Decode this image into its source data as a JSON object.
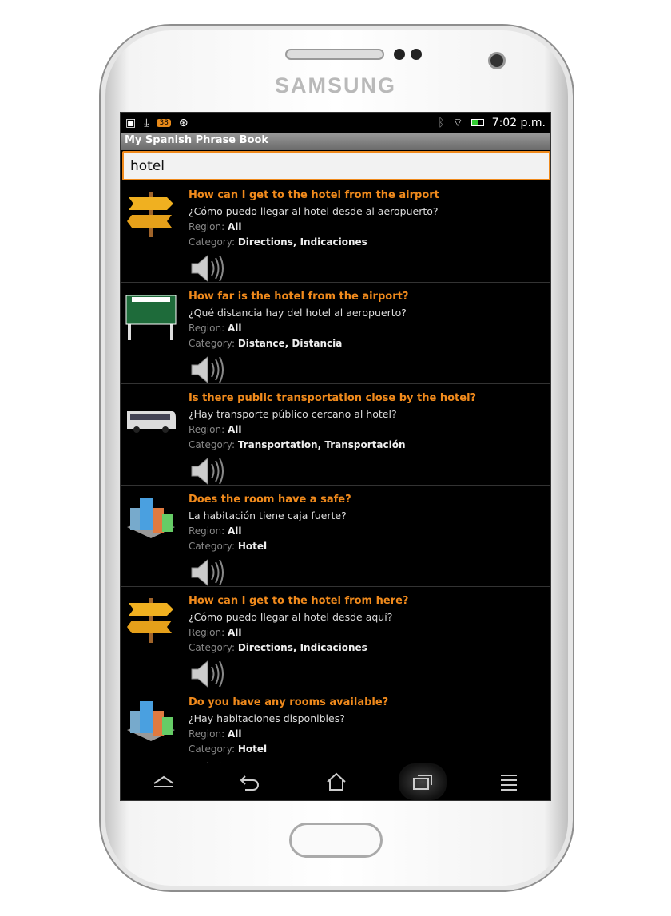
{
  "device": {
    "brand": "SAMSUNG"
  },
  "status": {
    "time": "7:02 p.m.",
    "badge": "38",
    "icons": [
      "picture-icon",
      "download-icon",
      "notification-badge-icon",
      "sync-icon",
      "bluetooth-icon",
      "wifi-icon",
      "battery-icon"
    ]
  },
  "app": {
    "title": "My Spanish Phrase Book"
  },
  "search": {
    "value": "hotel"
  },
  "labels": {
    "region": "Region:",
    "category": "Category:"
  },
  "accent": "#f08a1c",
  "items": [
    {
      "en": "How can I get to the hotel from the airport",
      "es": "¿Cómo puedo llegar al hotel desde al aeropuerto?",
      "region": "All",
      "category": "Directions, Indicaciones",
      "icon": "signpost-icon"
    },
    {
      "en": "How far is the hotel from the airport?",
      "es": "¿Qué distancia hay del hotel al aeropuerto?",
      "region": "All",
      "category": "Distance, Distancia",
      "icon": "highway-sign-icon"
    },
    {
      "en": "Is there public transportation close by the hotel?",
      "es": "¿Hay transporte público  cercano al hotel?",
      "region": "All",
      "category": "Transportation, Transportación",
      "icon": "bus-icon"
    },
    {
      "en": "Does the room have a safe?",
      "es": "La habitación tiene caja fuerte?",
      "region": "All",
      "category": "Hotel",
      "icon": "buildings-icon"
    },
    {
      "en": "How can I get to the hotel from here?",
      "es": "¿Cómo puedo llegar al hotel desde aquí?",
      "region": "All",
      "category": "Directions, Indicaciones",
      "icon": "signpost-icon"
    },
    {
      "en": "Do you have any rooms available?",
      "es": "¿Hay habitaciones disponibles?",
      "region": "All",
      "category": "Hotel",
      "icon": "buildings-icon"
    }
  ],
  "nav": [
    "up-icon",
    "back-icon",
    "home-icon",
    "recent-apps-icon",
    "menu-icon"
  ]
}
